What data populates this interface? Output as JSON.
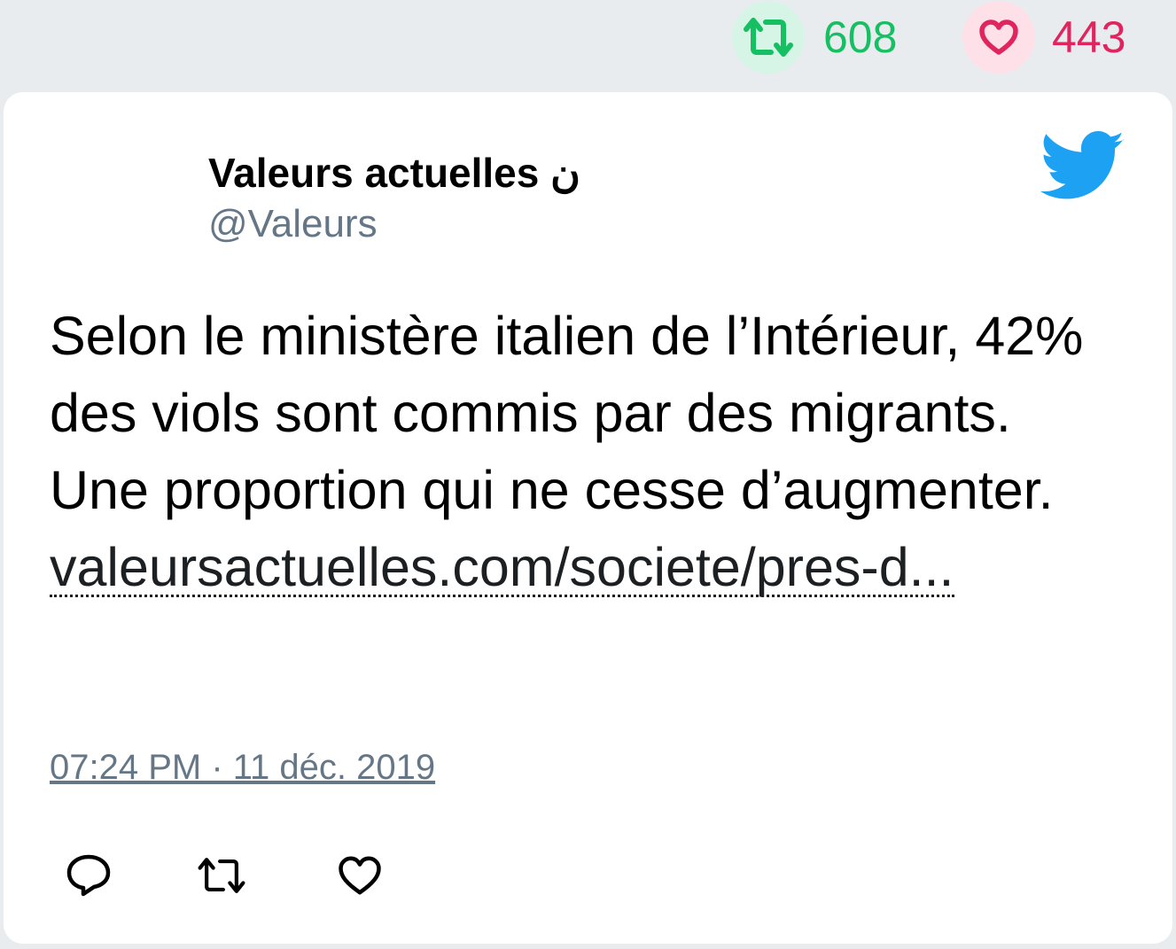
{
  "stats": {
    "retweet_count": "608",
    "like_count": "443"
  },
  "tweet": {
    "author_name": "Valeurs actuelles ن",
    "author_handle": "@Valeurs",
    "text": "Selon le ministère italien de l’Intérieur, 42% des viols sont commis par des migrants. Une proportion qui ne cesse d’augmenter.",
    "link_text": "valeursactuelles.com/societe/pres-d...",
    "timestamp": "07:24 PM · 11 déc. 2019"
  },
  "icons": {
    "stat_retweet": "retweet-icon",
    "stat_like": "heart-icon",
    "brand": "twitter-bird-icon",
    "reply": "reply-icon",
    "retweet": "retweet-icon",
    "like": "heart-icon"
  },
  "colors": {
    "retweet_green": "#17bf63",
    "like_red": "#e0245e",
    "twitter_blue": "#1da1f2",
    "handle_gray": "#657786"
  }
}
